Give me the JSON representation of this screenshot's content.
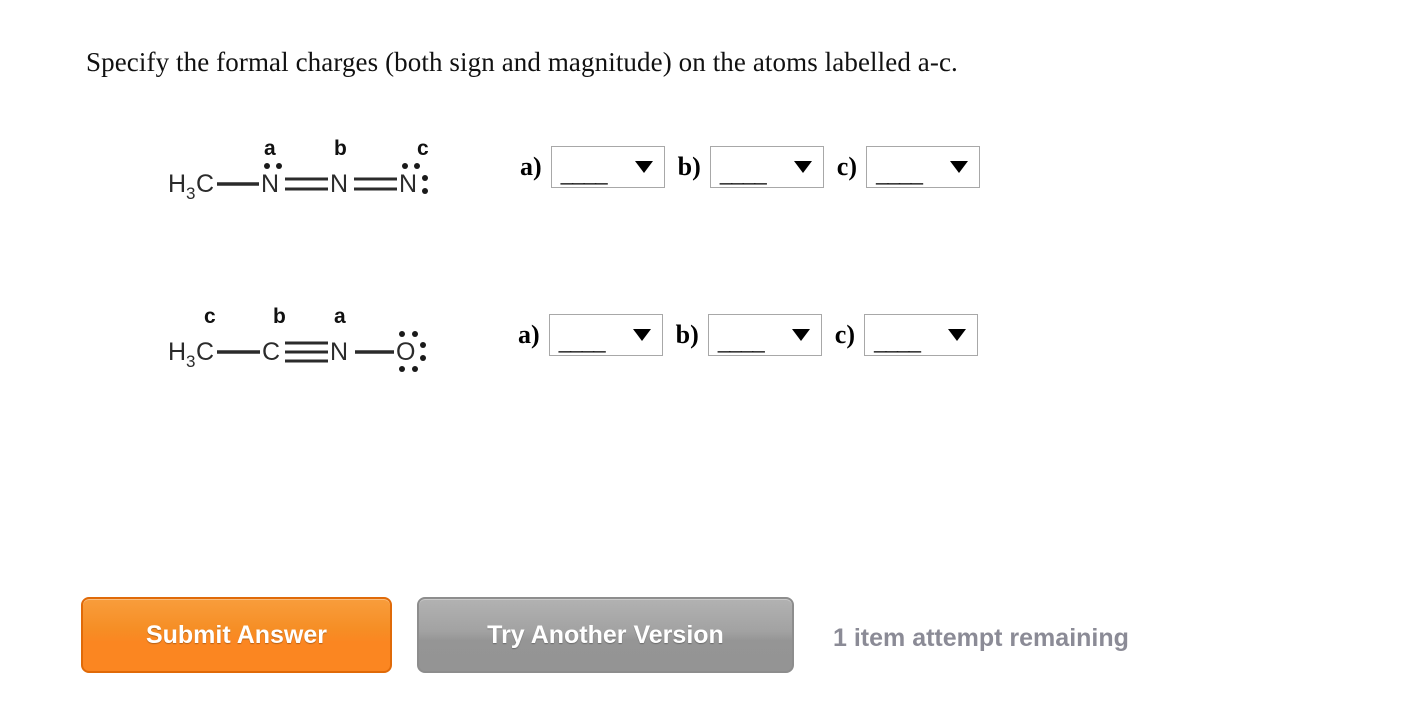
{
  "prompt": {
    "text": "Specify the formal charges (both sign and magnitude) on the atoms labelled a-c."
  },
  "structures": [
    {
      "id": "structure-1",
      "formula": "H3C-N=N=N:",
      "atoms": [
        {
          "symbol": "H",
          "subscript": "3"
        },
        {
          "symbol": "C"
        },
        {
          "symbol": "N",
          "label": "a"
        },
        {
          "symbol": "N",
          "label": "b"
        },
        {
          "symbol": "N",
          "label": "c"
        }
      ],
      "labels": [
        "a",
        "b",
        "c"
      ],
      "bonds": [
        "single",
        "double",
        "double"
      ]
    },
    {
      "id": "structure-2",
      "formula": "H3C-C#N-O:",
      "atoms": [
        {
          "symbol": "H",
          "subscript": "3"
        },
        {
          "symbol": "C",
          "label": "c"
        },
        {
          "symbol": "C",
          "label": "b"
        },
        {
          "symbol": "N",
          "label": "a"
        },
        {
          "symbol": "O"
        }
      ],
      "labels": [
        "c",
        "b",
        "a"
      ],
      "bonds": [
        "single",
        "triple",
        "single"
      ]
    }
  ],
  "answer_rows": [
    {
      "row_id": "answer-row-1",
      "dropdowns": [
        {
          "letter": "a)",
          "value": "____",
          "placeholder": "____"
        },
        {
          "letter": "b)",
          "value": "____",
          "placeholder": "____"
        },
        {
          "letter": "c)",
          "value": "____",
          "placeholder": "____"
        }
      ]
    },
    {
      "row_id": "answer-row-2",
      "dropdowns": [
        {
          "letter": "a)",
          "value": "____",
          "placeholder": "____"
        },
        {
          "letter": "b)",
          "value": "____",
          "placeholder": "____"
        },
        {
          "letter": "c)",
          "value": "____",
          "placeholder": "____"
        }
      ]
    }
  ],
  "footer": {
    "submit_label": "Submit Answer",
    "try_another_label": "Try Another Version",
    "attempts_text": "1 item attempt remaining"
  },
  "colors": {
    "submit_orange": "#fb8621",
    "submit_border": "#e06a08",
    "try_gray": "#959595",
    "try_border": "#8d8d8d",
    "attempts_gray": "#8b8b96",
    "dropdown_border": "#a8a8a8",
    "page_background": "#ffffff"
  }
}
